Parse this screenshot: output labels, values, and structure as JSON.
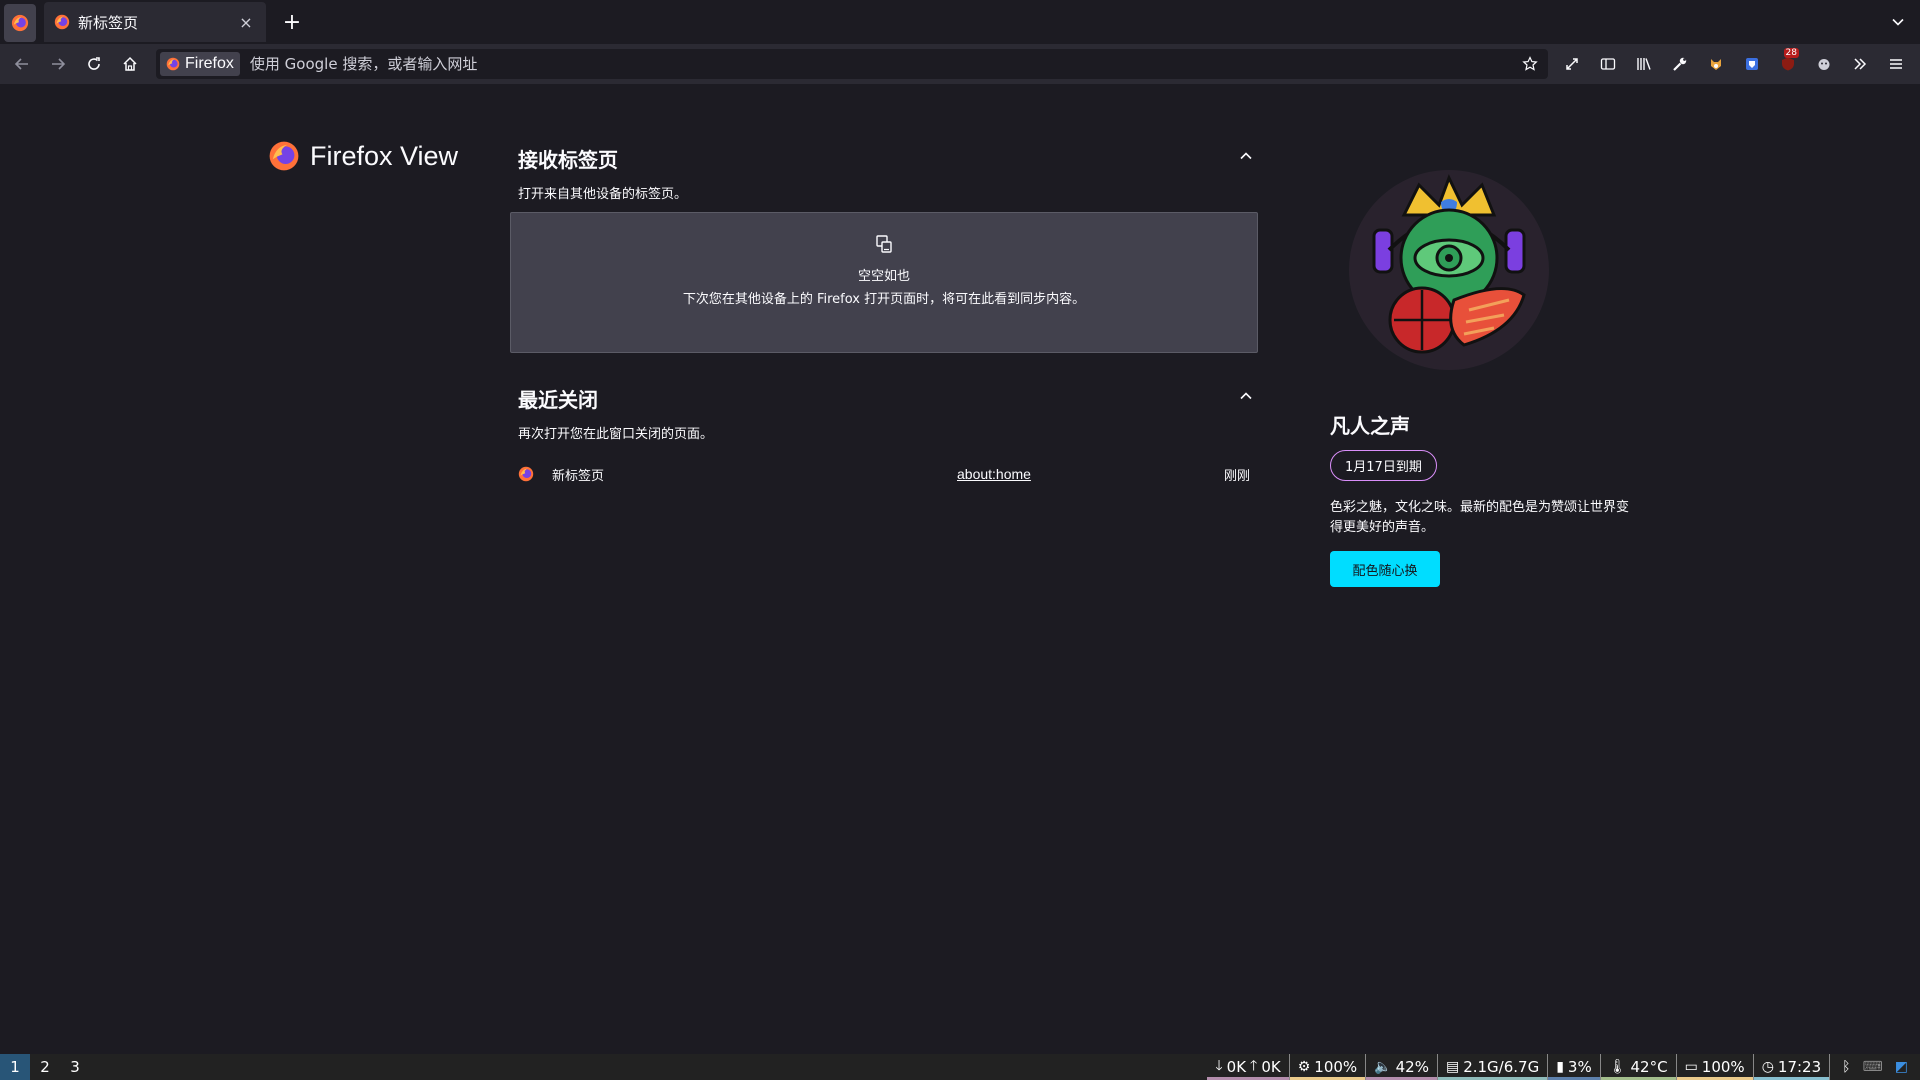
{
  "browser": {
    "tab": {
      "title": "新标签页",
      "close": "×"
    },
    "new_tab": "+",
    "identity_label": "Firefox",
    "url_placeholder": "使用 Google 搜索，或者输入网址",
    "extension_badge": "28"
  },
  "page": {
    "heading": "Firefox View",
    "received_tabs": {
      "title": "接收标签页",
      "description": "打开来自其他设备的标签页。",
      "empty_title": "空空如也",
      "empty_description": "下次您在其他设备上的 Firefox 打开页面时，将可在此看到同步内容。"
    },
    "recently_closed": {
      "title": "最近关闭",
      "description": "再次打开您在此窗口关闭的页面。",
      "items": [
        {
          "title": "新标签页",
          "url": "about:home",
          "time": "刚刚"
        }
      ]
    },
    "colorway": {
      "title": "凡人之声",
      "expiry": "1月17日到期",
      "description": "色彩之魅，文化之味。最新的配色是为赞颂让世界变得更美好的声音。",
      "button": "配色随心换"
    }
  },
  "statusbar": {
    "workspaces": [
      "1",
      "2",
      "3"
    ],
    "active_workspace": "1",
    "net_down": "0K",
    "net_up": "0K",
    "cpu": "100%",
    "volume": "42%",
    "memory": "2.1G/6.7G",
    "disk": "3%",
    "temperature": "42°C",
    "battery": "100%",
    "clock": "17:23"
  },
  "colors": {
    "accent": "#00ddff",
    "badge_border": "#d98ef9",
    "background": "#1c1b22",
    "toolbar": "#2b2a33",
    "card": "#42414d"
  }
}
